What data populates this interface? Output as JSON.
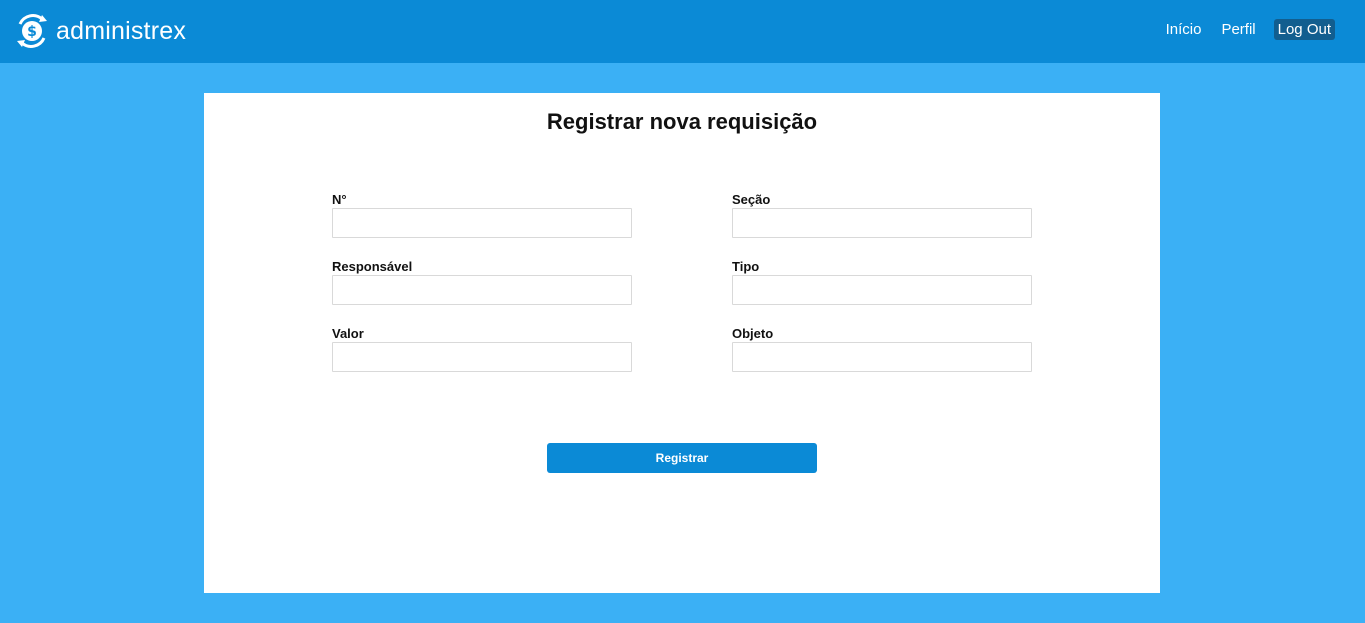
{
  "header": {
    "brand": "administrex",
    "brand_icon": "dollar-cycle-icon",
    "nav": {
      "home": "Início",
      "profile": "Perfil",
      "logout": "Log Out"
    }
  },
  "form": {
    "title": "Registrar nova requisição",
    "fields": {
      "numero": {
        "label": "N°",
        "value": ""
      },
      "secao": {
        "label": "Seção",
        "value": ""
      },
      "responsavel": {
        "label": "Responsável",
        "value": ""
      },
      "tipo": {
        "label": "Tipo",
        "value": ""
      },
      "valor": {
        "label": "Valor",
        "value": ""
      },
      "objeto": {
        "label": "Objeto",
        "value": ""
      }
    },
    "submit_label": "Registrar"
  },
  "colors": {
    "page_bg": "#3bb0f5",
    "header_bg": "#0b8ad6",
    "logout_bg": "#125e8f",
    "button_bg": "#0b8ad6"
  }
}
